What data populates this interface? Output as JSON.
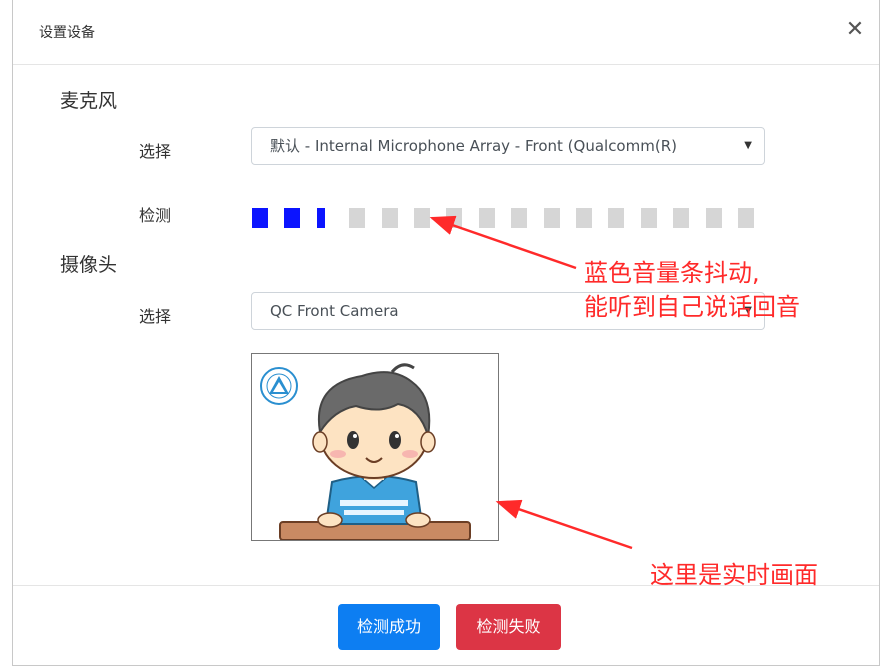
{
  "dialog": {
    "title": "设置设备",
    "close_glyph": "✕"
  },
  "microphone": {
    "section_title": "麦克风",
    "select_label": "选择",
    "selected_device": "默认 - Internal Microphone Array - Front (Qualcomm(R)",
    "detect_label": "检测",
    "level_bars_total": 16,
    "level_bars_active": 2.5,
    "active_color": "#0b14ff",
    "inactive_color": "#d6d6d6"
  },
  "camera": {
    "section_title": "摄像头",
    "select_label": "选择",
    "selected_device": "QC Front Camera"
  },
  "footer": {
    "success_label": "检测成功",
    "fail_label": "检测失败",
    "success_color": "#0d7ef2",
    "fail_color": "#dc3545"
  },
  "annotations": {
    "meter_note_line1": "蓝色音量条抖动,",
    "meter_note_line2": "能听到自己说话回音",
    "camera_note": "这里是实时画面",
    "color": "#ff2a2a"
  }
}
